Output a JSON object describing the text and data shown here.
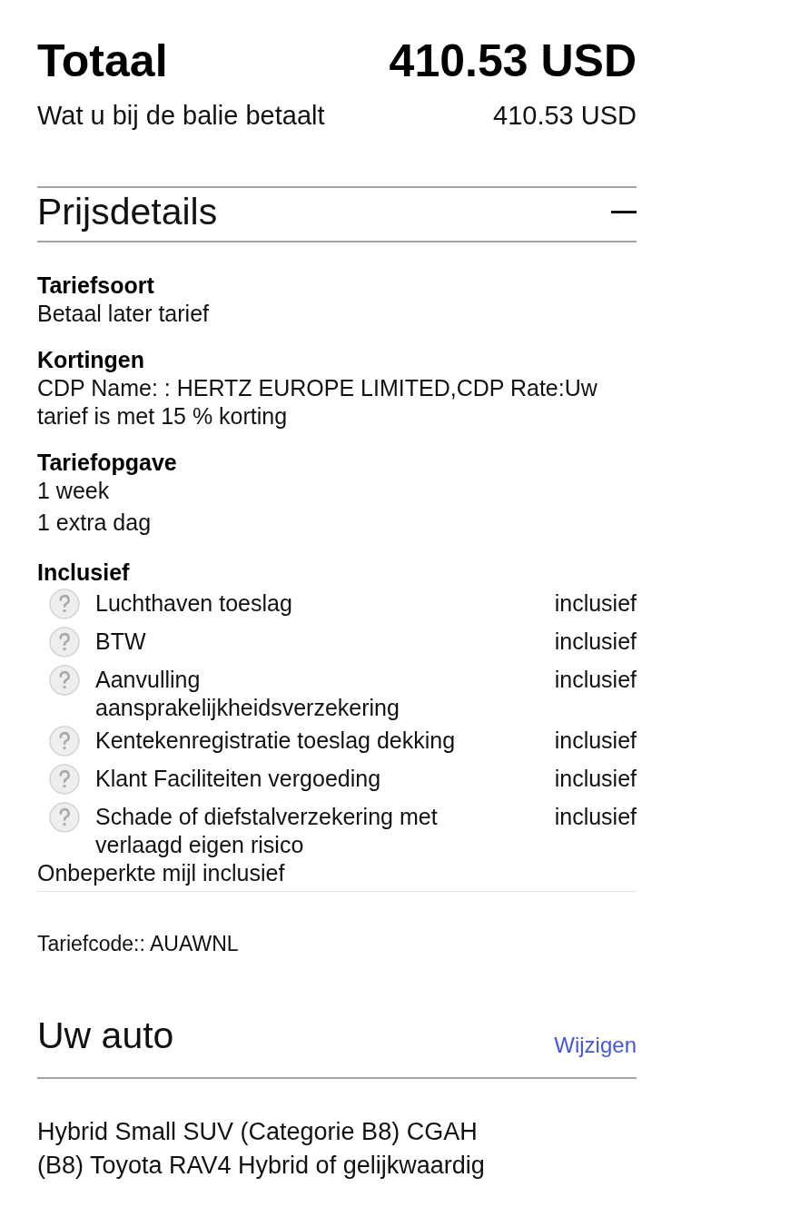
{
  "total": {
    "label": "Totaal",
    "amount": "410.53 USD"
  },
  "counter_payment": {
    "label": "Wat u bij de balie betaalt",
    "amount": "410.53 USD"
  },
  "price_details": {
    "title": "Prijsdetails",
    "expanded": true,
    "sections": [
      {
        "heading": "Tariefsoort",
        "lines": [
          "Betaal later tarief"
        ]
      },
      {
        "heading": "Kortingen",
        "lines": [
          "CDP Name: : HERTZ EUROPE LIMITED,CDP Rate:Uw tarief is met 15 % korting"
        ]
      },
      {
        "heading": "Tariefopgave",
        "lines": [
          "1 week",
          "1 extra dag"
        ]
      }
    ],
    "included": {
      "heading": "Inclusief",
      "items": [
        {
          "name": "Luchthaven toeslag",
          "status": "inclusief"
        },
        {
          "name": "BTW",
          "status": "inclusief"
        },
        {
          "name": "Aanvulling aansprakelijkheidsverzekering",
          "status": "inclusief"
        },
        {
          "name": "Kentekenregistratie toeslag dekking",
          "status": "inclusief"
        },
        {
          "name": "Klant Faciliteiten vergoeding",
          "status": "inclusief"
        },
        {
          "name": "Schade of diefstalverzekering met verlaagd eigen risico",
          "status": "inclusief"
        }
      ],
      "note": "Onbeperkte mijl inclusief"
    },
    "rate_code": "Tariefcode:: AUAWNL"
  },
  "car": {
    "title": "Uw auto",
    "change_link": "Wijzigen",
    "description": [
      "Hybrid Small SUV (Categorie B8) CGAH",
      "(B8) Toyota RAV4 Hybrid of gelijkwaardig"
    ]
  }
}
